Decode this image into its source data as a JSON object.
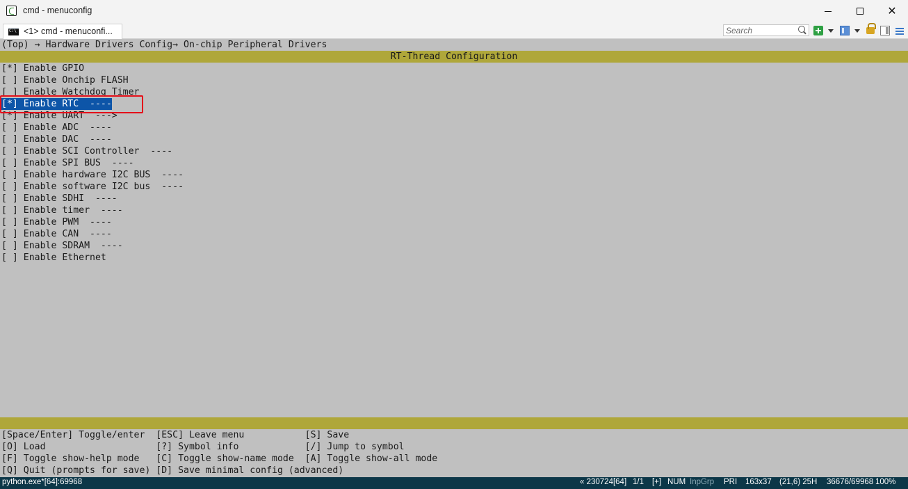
{
  "window": {
    "title": "cmd - menuconfig"
  },
  "tab": {
    "label": "<1> cmd - menuconfi..."
  },
  "search": {
    "placeholder": "Search"
  },
  "breadcrumb": "(Top) → Hardware Drivers Config→ On-chip Peripheral Drivers",
  "header_title": "RT-Thread Configuration",
  "menu_items": [
    "[*] Enable GPIO",
    "[ ] Enable Onchip FLASH",
    "[ ] Enable Watchdog Timer",
    "[*] Enable RTC  ----",
    "[*] Enable UART  --->",
    "[ ] Enable ADC  ----",
    "[ ] Enable DAC  ----",
    "[ ] Enable SCI Controller  ----",
    "[ ] Enable SPI BUS  ----",
    "[ ] Enable hardware I2C BUS  ----",
    "[ ] Enable software I2C bus  ----",
    "[ ] Enable SDHI  ----",
    "[ ] Enable timer  ----",
    "[ ] Enable PWM  ----",
    "[ ] Enable CAN  ----",
    "[ ] Enable SDRAM  ----",
    "[ ] Enable Ethernet"
  ],
  "help_lines": [
    "[Space/Enter] Toggle/enter  [ESC] Leave menu           [S] Save",
    "[O] Load                    [?] Symbol info            [/] Jump to symbol",
    "[F] Toggle show-help mode   [C] Toggle show-name mode  [A] Toggle show-all mode",
    "[Q] Quit (prompts for save) [D] Save minimal config (advanced)"
  ],
  "status": {
    "process": "python.exe*[64]:69968",
    "build": "« 230724[64]",
    "page": "1/1",
    "plus": "[+]",
    "num": "NUM",
    "inpgrp": "InpGrp",
    "pri": "PRI",
    "size": "163x37",
    "cursor": "(21,6) 25H",
    "memory": "36676/69968",
    "zoom": "100%"
  },
  "colors": {
    "console_bg": "#c0c0c0",
    "band": "#afa73a",
    "selection": "#0d55a8",
    "highlight_box": "#e4101a",
    "statusbar": "#0c3748"
  }
}
